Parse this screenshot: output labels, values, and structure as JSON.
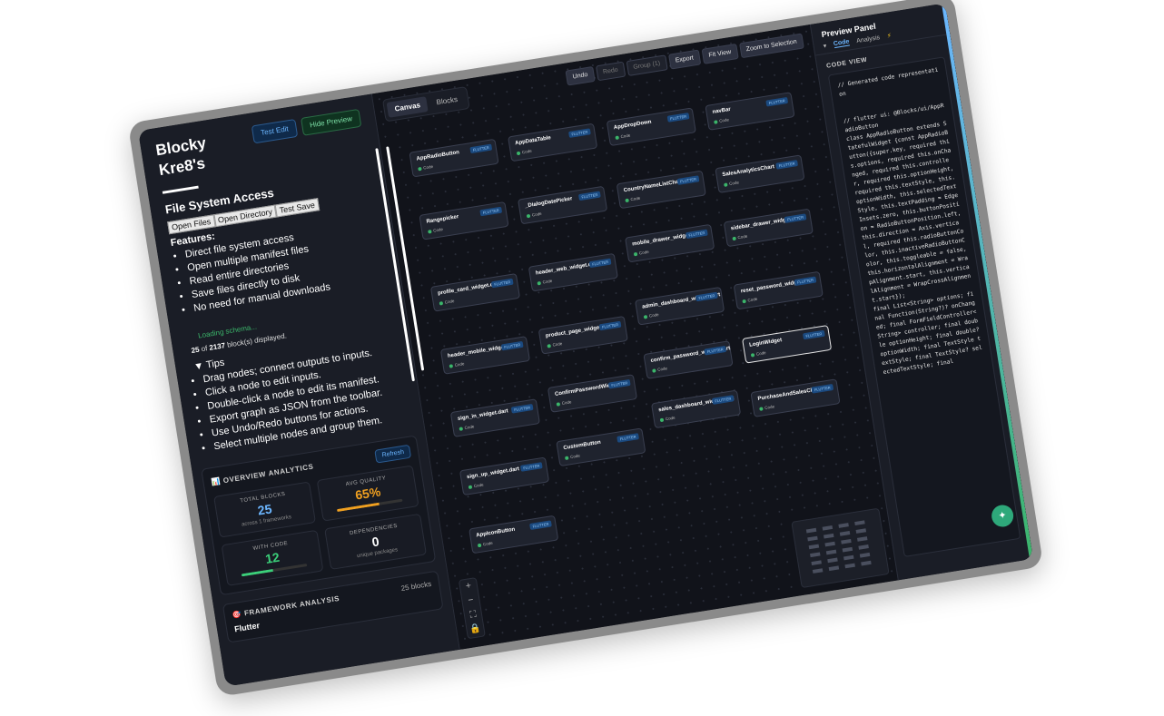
{
  "app": {
    "title": "Blocky Kre8's",
    "test_edit": "Test Edit",
    "hide_preview": "Hide Preview"
  },
  "file_system": {
    "title": "File System Access",
    "links": [
      "Open Files",
      "Open Directory",
      "Test Save"
    ],
    "features_label": "Features:",
    "features": [
      "Direct file system access",
      "Open multiple manifest files",
      "Read entire directories",
      "Save files directly to disk",
      "No need for manual downloads"
    ]
  },
  "status": {
    "loading": "Loading schema...",
    "count_shown": "25",
    "count_of": "of",
    "count_total": "2137",
    "count_suffix": "block(s) displayed."
  },
  "tips": {
    "title": "▼ Tips",
    "items": [
      "Drag nodes; connect outputs to inputs.",
      "Click a node to edit inputs.",
      "Double-click a node to edit its manifest.",
      "Export graph as JSON from the toolbar.",
      "Use Undo/Redo buttons for actions.",
      "Select multiple nodes and group them."
    ]
  },
  "analytics": {
    "title": "📊 OVERVIEW ANALYTICS",
    "refresh": "Refresh",
    "total_blocks_label": "TOTAL BLOCKS",
    "total_blocks_value": "25",
    "total_blocks_sub": "across 1 frameworks",
    "avg_quality_label": "AVG QUALITY",
    "avg_quality_value": "65%",
    "avg_quality_fraction": 0.65,
    "with_code_label": "WITH CODE",
    "with_code_value": "12",
    "with_code_fraction": 0.48,
    "dependencies_label": "DEPENDENCIES",
    "dependencies_value": "0",
    "dependencies_sub": "unique packages"
  },
  "framework": {
    "title": "🎯 FRAMEWORK ANALYSIS",
    "count": "25 blocks",
    "name": "Flutter"
  },
  "canvas": {
    "tabs": [
      "Canvas",
      "Blocks"
    ],
    "toolbar": [
      "Undo",
      "Redo",
      "Group (1)",
      "Export",
      "Fit View",
      "Zoom to Selection"
    ],
    "node_tag": "FLUTTER",
    "node_code": "Code",
    "nodes": [
      "AppRadioButton",
      "AppDataTable",
      "AppDropDown",
      "navBar",
      "Rangepicker",
      "_DialogDatePicker",
      "CountryNameListChart",
      "SalesAnalyticsChart",
      "mobile_drawer_widget.dart",
      "sidebar_drawer_widget.dart",
      "profile_card_widget.dart",
      "header_web_widget.dart",
      "reset_password_widget.dart",
      "header_mobile_widget.dart",
      "product_page_widget.dart",
      "admin_dashboard_widget.dart",
      "LoginWidget",
      "confirm_password_widget.dart",
      "sign_in_widget.dart",
      "ConfirmPasswordWidget",
      "sales_dashboard_widget.dart",
      "PurchaseAndSalesChart",
      "sign_up_widget.dart",
      "CustomButton",
      "AppIconButton"
    ],
    "zoom_controls": [
      "+",
      "−",
      "⛶",
      "🔒"
    ]
  },
  "preview": {
    "title": "Preview Panel",
    "tabs": [
      "Code",
      "Analysis"
    ],
    "section": "CODE VIEW",
    "code": "// Generated code representation\n\n\n// flutter ui: @Blocks/ui/AppRadioButton\nclass AppRadioButton extends StatefulWidget {const AppRadioButton({super.key, required this.options, required this.onChanged, required this.controller, required this.optionHeight, required this.textStyle, this.optionWidth, this.selectedTextStyle, this.textPadding = EdgeInsets.zero, this.buttonPosition = RadioButtonPosition.left, this.direction = Axis.vertical, required this.radioButtonColor, this.inactiveRadioButtonColor, this.toggleable = false, this.horizontalAlignment = WrapAlignment.start, this.verticalAlignment = WrapCrossAlignment.start});\nfinal List<String> options; final Function(String?)? onChanged; final FormFieldController<String> controller; final double optionHeight; final double? optionWidth; final TextStyle textStyle; final TextStyle? selectedTextStyle; final"
  }
}
